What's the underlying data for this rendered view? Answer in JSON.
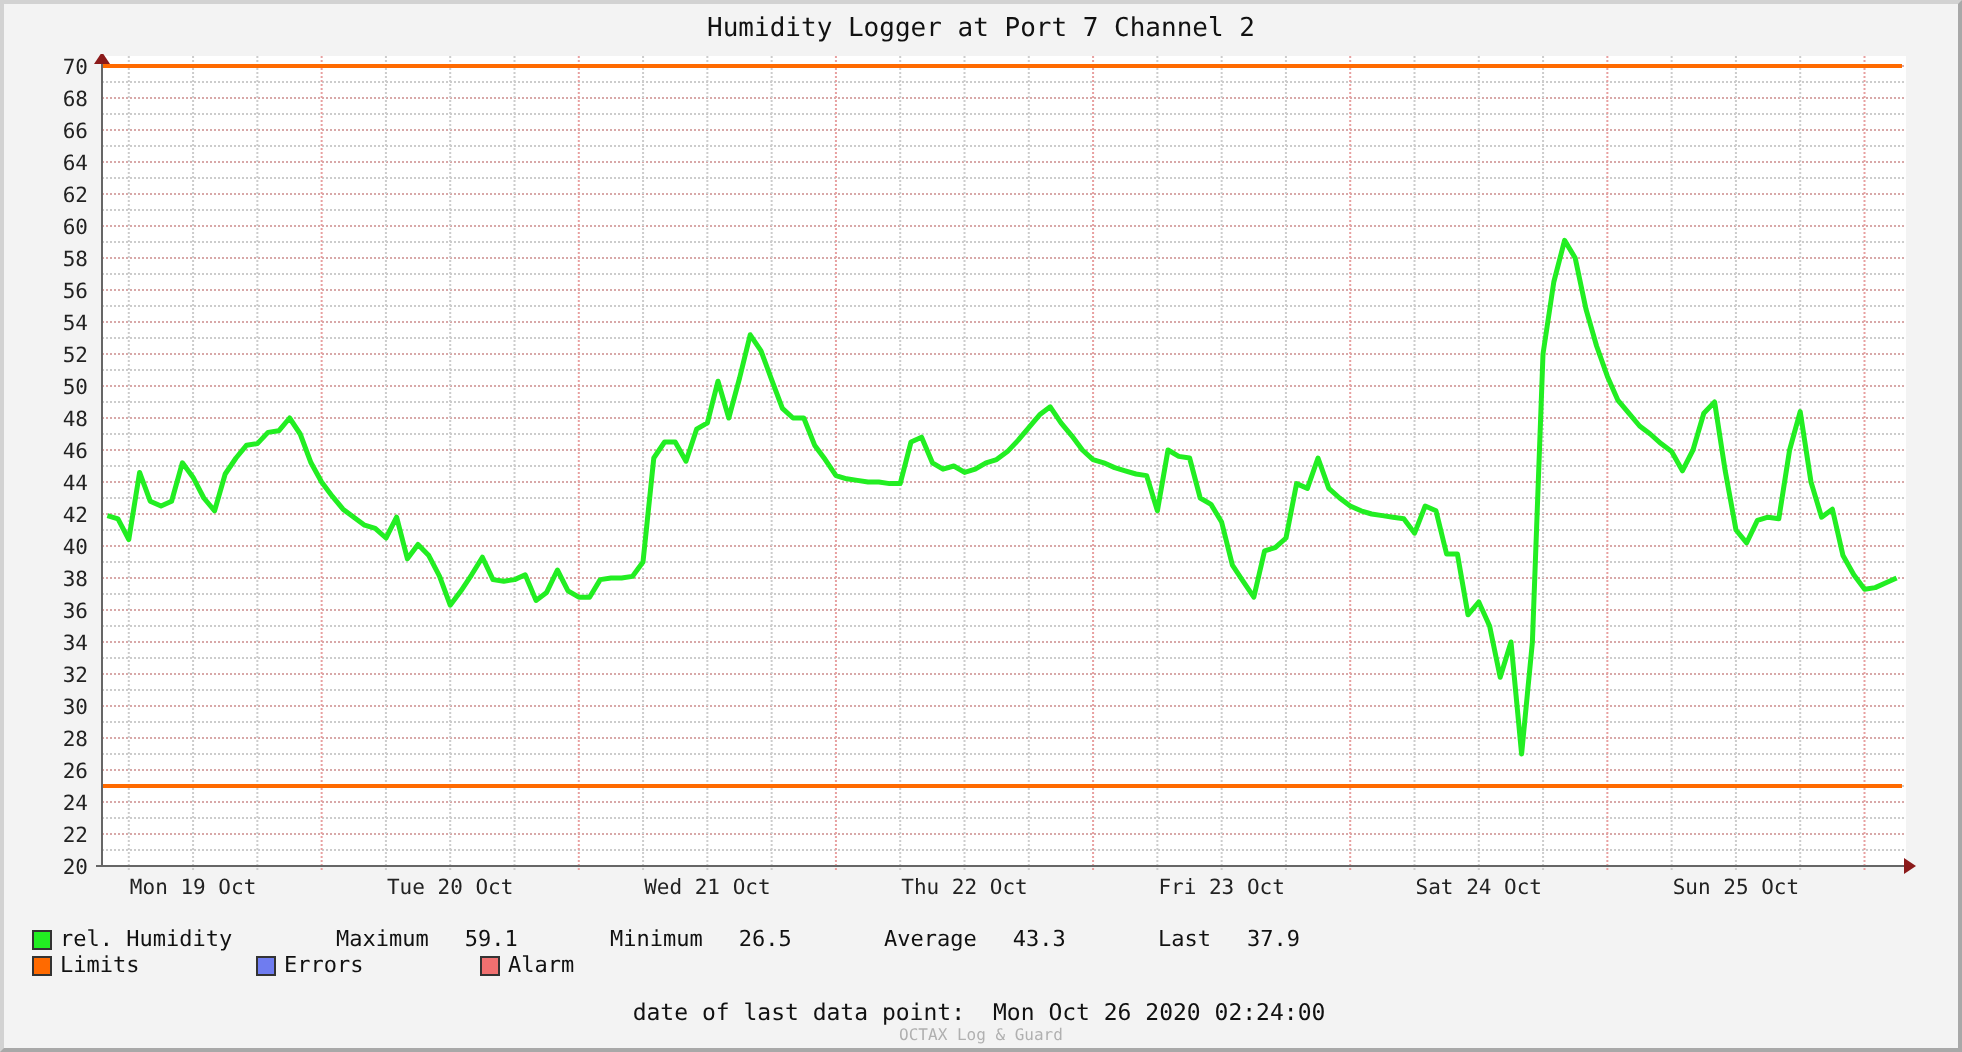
{
  "title": "Humidity Logger at Port 7 Channel 2",
  "chart_data": {
    "type": "line",
    "ylim": [
      20,
      70
    ],
    "categories": [
      null,
      null,
      null,
      null,
      null,
      null,
      null,
      null,
      "Mon 19 Oct",
      null,
      null,
      null,
      null,
      null,
      null,
      null,
      null,
      null,
      null,
      null,
      null,
      null,
      null,
      null,
      null,
      null,
      null,
      null,
      null,
      null,
      null,
      null,
      "Tue 20 Oct",
      null,
      null,
      null,
      null,
      null,
      null,
      null,
      null,
      null,
      null,
      null,
      null,
      null,
      null,
      null,
      null,
      null,
      null,
      null,
      null,
      null,
      null,
      null,
      "Wed 21 Oct",
      null,
      null,
      null,
      null,
      null,
      null,
      null,
      null,
      null,
      null,
      null,
      null,
      null,
      null,
      null,
      null,
      null,
      null,
      null,
      null,
      null,
      null,
      null,
      "Thu 22 Oct",
      null,
      null,
      null,
      null,
      null,
      null,
      null,
      null,
      null,
      null,
      null,
      null,
      null,
      null,
      null,
      null,
      null,
      null,
      null,
      null,
      null,
      null,
      null,
      "Fri 23 Oct",
      null,
      null,
      null,
      null,
      null,
      null,
      null,
      null,
      null,
      null,
      null,
      null,
      null,
      null,
      null,
      null,
      null,
      null,
      null,
      null,
      null,
      null,
      null,
      "Sat 24 Oct",
      null,
      null,
      null,
      null,
      null,
      null,
      null,
      null,
      null,
      null,
      null,
      null,
      null,
      null,
      null,
      null,
      null,
      null,
      null,
      null,
      null,
      null,
      null,
      "Sun 25 Oct",
      null,
      null,
      null,
      null,
      null,
      null,
      null,
      null,
      null,
      null,
      null,
      null,
      null,
      null,
      null
    ],
    "yticks": [
      20,
      22,
      24,
      26,
      28,
      30,
      32,
      34,
      36,
      38,
      40,
      42,
      44,
      46,
      48,
      50,
      52,
      54,
      56,
      58,
      60,
      62,
      64,
      66,
      68,
      70
    ],
    "series": [
      {
        "name": "rel. Humidity",
        "color": "#22ee22",
        "values": [
          41.9,
          41.7,
          40.4,
          44.6,
          42.8,
          42.5,
          42.8,
          45.2,
          44.3,
          43,
          42.2,
          44.5,
          45.5,
          46.3,
          46.4,
          47.1,
          47.2,
          48,
          47,
          45.2,
          44,
          43.1,
          42.3,
          41.8,
          41.3,
          41.1,
          40.5,
          41.8,
          39.2,
          40.1,
          39.4,
          38.1,
          36.3,
          37.2,
          38.2,
          39.3,
          37.9,
          37.8,
          37.9,
          38.2,
          36.6,
          37.1,
          38.5,
          37.2,
          36.8,
          36.8,
          37.9,
          38,
          38,
          38.1,
          39,
          45.5,
          46.5,
          46.5,
          45.3,
          47.3,
          47.7,
          50.3,
          48,
          50.5,
          53.2,
          52.2,
          50.4,
          48.6,
          48,
          48,
          46.3,
          45.4,
          44.4,
          44.2,
          44.1,
          44,
          44,
          43.9,
          43.9,
          46.5,
          46.8,
          45.2,
          44.8,
          45,
          44.6,
          44.8,
          45.2,
          45.4,
          45.9,
          46.6,
          47.4,
          48.2,
          48.7,
          47.7,
          46.9,
          46,
          45.4,
          45.2,
          44.9,
          44.7,
          44.5,
          44.4,
          42.2,
          46,
          45.6,
          45.5,
          43,
          42.6,
          41.5,
          38.8,
          37.8,
          36.8,
          39.7,
          39.9,
          40.5,
          43.9,
          43.6,
          45.5,
          43.6,
          43,
          42.5,
          42.2,
          42,
          41.9,
          41.8,
          41.7,
          40.8,
          42.5,
          42.2,
          39.5,
          39.5,
          35.7,
          36.5,
          35,
          31.8,
          34,
          27,
          34,
          52,
          56.5,
          59.1,
          58,
          54.8,
          52.5,
          50.6,
          49.1,
          48.3,
          47.5,
          47,
          46.4,
          45.9,
          44.7,
          46,
          48.3,
          49,
          44.7,
          41,
          40.2,
          41.6,
          41.8,
          41.7,
          46,
          48.4,
          44,
          41.8,
          42.3,
          39.4,
          38.2,
          37.3,
          37.4,
          37.7,
          38
        ]
      }
    ],
    "grid": true,
    "ref_lines": [
      {
        "axis": "y",
        "value": 70,
        "color": "#ff6a00"
      },
      {
        "axis": "y",
        "value": 25,
        "color": "#ff6a00"
      }
    ]
  },
  "legend": [
    {
      "stats": [
        {
          "label": "Maximum",
          "value": "59.1"
        },
        {
          "label": "Minimum",
          "value": "26.5"
        },
        {
          "label": "Average",
          "value": "43.3"
        },
        {
          "label": "Last",
          "value": "37.9"
        }
      ]
    },
    {
      "label": "Limits",
      "color": "#ff6a00"
    },
    {
      "label": "Errors",
      "color": "#6f7cf0"
    },
    {
      "label": "Alarm",
      "color": "#f07070"
    }
  ],
  "footer": {
    "label": "date of last data point:",
    "value": "Mon Oct 26 2020 02:24:00"
  },
  "watermark": "OCTAX Log & Guard"
}
